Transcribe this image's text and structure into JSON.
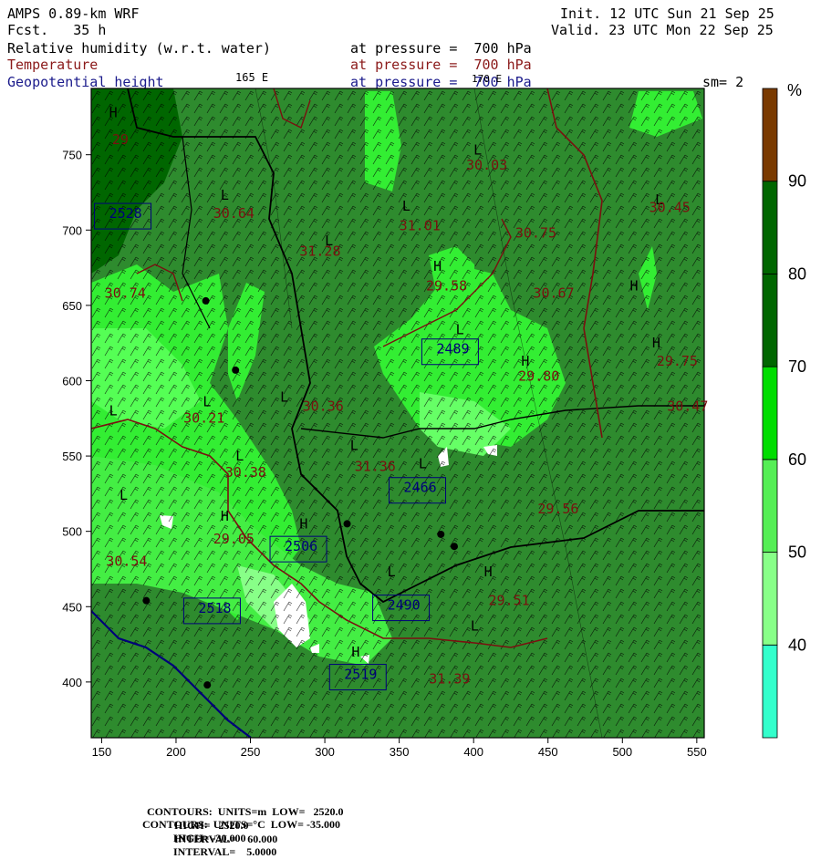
{
  "header": {
    "model": "AMPS 0.89-km WRF",
    "forecast": "Fcst.   35 h",
    "init": "Init. 12 UTC Sun 21 Sep 25",
    "valid": "Valid. 23 UTC Mon 22 Sep 25",
    "field1_name": "Relative humidity (w.r.t. water)",
    "field1_level": "at pressure =  700 hPa",
    "field2_name": "Temperature",
    "field2_level": "at pressure =  700 hPa",
    "field3_name": "Geopotential height",
    "field3_level": "at pressure =  700 hPa",
    "lon_label_1": "165 E",
    "lon_label_2": "170 E",
    "smoothing": "sm= 2"
  },
  "colorbar": {
    "unit": "%",
    "ticks": [
      "40",
      "50",
      "60",
      "70",
      "80",
      "90"
    ],
    "colors": [
      "#33ffcc",
      "#88ff88",
      "#33ee33",
      "#00cc00",
      "#006600",
      "#7a3a00"
    ]
  },
  "map": {
    "x_ticks": [
      "150",
      "200",
      "250",
      "300",
      "350",
      "400",
      "450",
      "500",
      "550"
    ],
    "y_ticks": [
      "750",
      "700",
      "650",
      "600",
      "550",
      "500",
      "450",
      "400"
    ],
    "x_range": [
      143,
      555
    ],
    "y_range": [
      363,
      794
    ],
    "background_color": "#2e8b2e",
    "height_labels": [
      {
        "text": "H",
        "x": 155,
        "y": 775
      },
      {
        "text": "29",
        "x": 157,
        "y": 757
      },
      {
        "text": "2528",
        "x": 155,
        "y": 708
      },
      {
        "text": "L",
        "x": 230,
        "y": 720
      },
      {
        "text": "30.64",
        "x": 225,
        "y": 708
      },
      {
        "text": "L",
        "x": 400,
        "y": 750
      },
      {
        "text": "30.03",
        "x": 395,
        "y": 740
      },
      {
        "text": "L",
        "x": 352,
        "y": 713
      },
      {
        "text": "31.01",
        "x": 350,
        "y": 700
      },
      {
        "text": "L",
        "x": 300,
        "y": 690
      },
      {
        "text": "31.28",
        "x": 283,
        "y": 683
      },
      {
        "text": "30.75",
        "x": 428,
        "y": 695
      },
      {
        "text": "L",
        "x": 522,
        "y": 717
      },
      {
        "text": "30.45",
        "x": 518,
        "y": 712
      },
      {
        "text": "H",
        "x": 373,
        "y": 673
      },
      {
        "text": "29.58",
        "x": 368,
        "y": 660
      },
      {
        "text": "30.67",
        "x": 440,
        "y": 655
      },
      {
        "text": "H",
        "x": 505,
        "y": 660
      },
      {
        "text": "30.74",
        "x": 152,
        "y": 655
      },
      {
        "text": "L",
        "x": 388,
        "y": 631
      },
      {
        "text": "2489",
        "x": 375,
        "y": 618
      },
      {
        "text": "H",
        "x": 520,
        "y": 622
      },
      {
        "text": "29.75",
        "x": 523,
        "y": 610
      },
      {
        "text": "H",
        "x": 432,
        "y": 610
      },
      {
        "text": "29.80",
        "x": 430,
        "y": 600
      },
      {
        "text": "L",
        "x": 218,
        "y": 583
      },
      {
        "text": "30.21",
        "x": 205,
        "y": 572
      },
      {
        "text": "L",
        "x": 270,
        "y": 586
      },
      {
        "text": "30.36",
        "x": 285,
        "y": 580
      },
      {
        "text": "L",
        "x": 155,
        "y": 577
      },
      {
        "text": "30.47",
        "x": 530,
        "y": 580
      },
      {
        "text": "L",
        "x": 240,
        "y": 547
      },
      {
        "text": "30.38",
        "x": 233,
        "y": 536
      },
      {
        "text": "L",
        "x": 317,
        "y": 554
      },
      {
        "text": "31.36",
        "x": 320,
        "y": 540
      },
      {
        "text": "L",
        "x": 363,
        "y": 542
      },
      {
        "text": "2466",
        "x": 353,
        "y": 526
      },
      {
        "text": "29.56",
        "x": 443,
        "y": 512
      },
      {
        "text": "L",
        "x": 162,
        "y": 521
      },
      {
        "text": "H",
        "x": 230,
        "y": 507
      },
      {
        "text": "29.05",
        "x": 225,
        "y": 492
      },
      {
        "text": "H",
        "x": 283,
        "y": 502
      },
      {
        "text": "2506",
        "x": 273,
        "y": 487
      },
      {
        "text": "30.54",
        "x": 153,
        "y": 477
      },
      {
        "text": "L",
        "x": 342,
        "y": 470
      },
      {
        "text": "2518",
        "x": 215,
        "y": 446
      },
      {
        "text": "2490",
        "x": 342,
        "y": 448
      },
      {
        "text": "H",
        "x": 407,
        "y": 470
      },
      {
        "text": "29.51",
        "x": 410,
        "y": 451
      },
      {
        "text": "L",
        "x": 398,
        "y": 434
      },
      {
        "text": "H",
        "x": 318,
        "y": 417
      },
      {
        "text": "2519",
        "x": 313,
        "y": 402
      },
      {
        "text": "31.39",
        "x": 370,
        "y": 399
      }
    ],
    "stations": [
      {
        "x": 220,
        "y": 653
      },
      {
        "x": 240,
        "y": 607
      },
      {
        "x": 315,
        "y": 505
      },
      {
        "x": 378,
        "y": 498
      },
      {
        "x": 387,
        "y": 490
      },
      {
        "x": 180,
        "y": 454
      },
      {
        "x": 221,
        "y": 398
      }
    ]
  },
  "footer": {
    "line1_label": "CONTOURS:  UNITS=m  LOW=   2520.0",
    "line1_high": "HIGH=   2520.0",
    "line1_interval": "INTERVAL=    60.000",
    "line2_label": "CONTOURS:  UNITS=°C  LOW= -35.000",
    "line2_high": "HIGH= -30.000",
    "line2_interval": "INTERVAL=    5.0000",
    "line1_color": "#00007a",
    "line2_color": "#7a0000"
  }
}
